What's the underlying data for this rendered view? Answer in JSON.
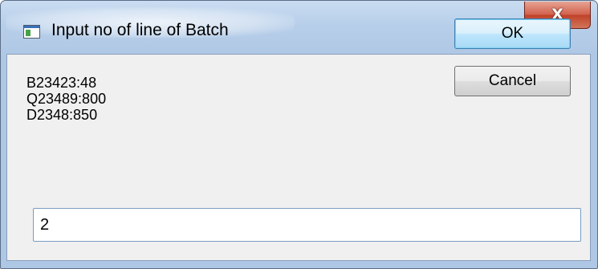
{
  "window": {
    "title": "Input no of line of Batch",
    "close_glyph": "X"
  },
  "message": {
    "lines": [
      "B23423:48",
      "Q23489:800",
      "D2348:850"
    ]
  },
  "buttons": {
    "ok_label": "OK",
    "cancel_label": "Cancel"
  },
  "input": {
    "value": "2"
  },
  "icons": {
    "app": "app-window-icon",
    "close": "close-icon"
  },
  "colors": {
    "titlebar": "#b8cfea",
    "close_button": "#c0422a",
    "client_background": "#f0f0f0",
    "default_button_border": "#3c7fb1"
  }
}
